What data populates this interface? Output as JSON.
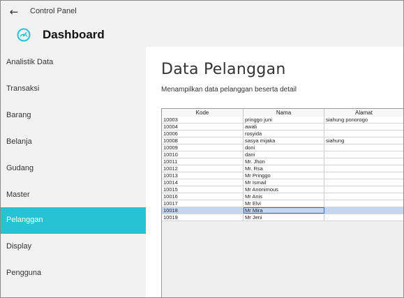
{
  "window": {
    "title": "Control Panel",
    "back_icon": "back-arrow-icon"
  },
  "app": {
    "title": "Dashboard",
    "icon": "speedometer-icon",
    "accent": "#25c3d3"
  },
  "sidebar": {
    "items": [
      {
        "label": "Analistik Data"
      },
      {
        "label": "Transaksi"
      },
      {
        "label": "Barang"
      },
      {
        "label": "Belanja"
      },
      {
        "label": "Gudang"
      },
      {
        "label": "Master"
      },
      {
        "label": "Pelanggan",
        "active": true
      },
      {
        "label": "Display"
      },
      {
        "label": "Pengguna"
      }
    ]
  },
  "main": {
    "title": "Data Pelanggan",
    "subtitle": "Menampilkan data pelanggan beserta detail",
    "table": {
      "columns": [
        "Kode",
        "Nama",
        "Alamat"
      ],
      "selected_row": 13,
      "rows": [
        [
          "10003",
          "pringgo juni",
          "siahung ponorogo"
        ],
        [
          "10004",
          "awali",
          ""
        ],
        [
          "10006",
          "rosyida",
          ""
        ],
        [
          "10008",
          "sasya mijaka",
          "siahung"
        ],
        [
          "10009",
          "doni",
          ""
        ],
        [
          "10010",
          "dani",
          ""
        ],
        [
          "10011",
          "Mr. Jhon",
          ""
        ],
        [
          "10012",
          "Mr. Rsa",
          ""
        ],
        [
          "10013",
          "Mr Pringgo",
          ""
        ],
        [
          "10014",
          "Mr Ismail",
          ""
        ],
        [
          "10015",
          "Mr Anonimous",
          ""
        ],
        [
          "10016",
          "Mr Anis",
          ""
        ],
        [
          "10017",
          "Mr Elvi",
          ""
        ],
        [
          "10018",
          "Mr Mira",
          ""
        ],
        [
          "10019",
          "Mr Jeni",
          ""
        ]
      ]
    }
  }
}
